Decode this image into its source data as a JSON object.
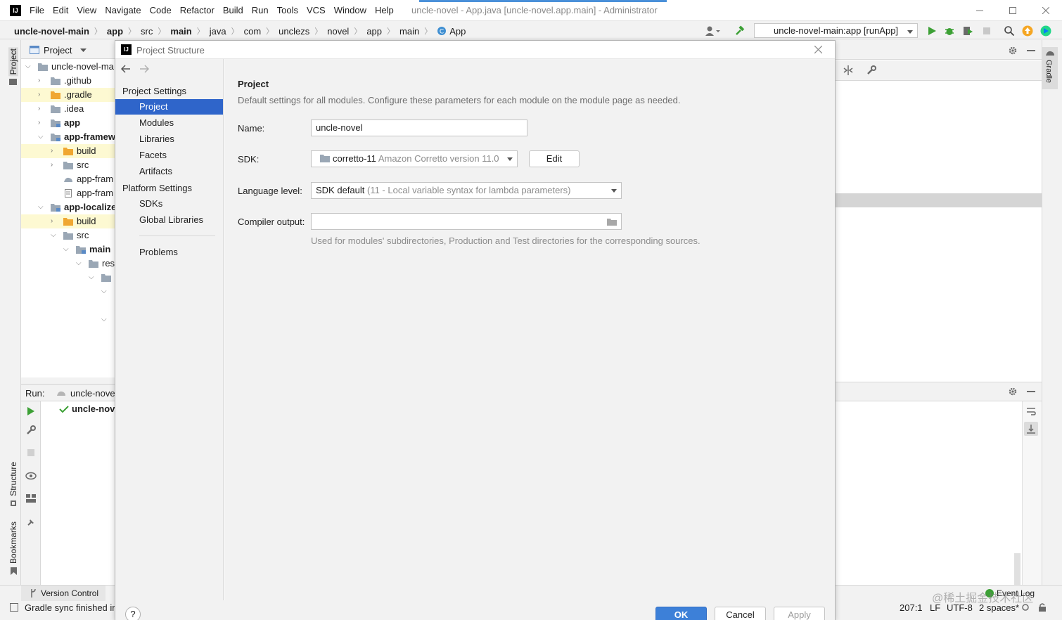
{
  "window": {
    "title": "uncle-novel - App.java [uncle-novel.app.main] - Administrator",
    "menu": [
      "File",
      "Edit",
      "View",
      "Navigate",
      "Code",
      "Refactor",
      "Build",
      "Run",
      "Tools",
      "VCS",
      "Window",
      "Help"
    ]
  },
  "navbar": {
    "crumbs": [
      "uncle-novel-main",
      "app",
      "src",
      "main",
      "java",
      "com",
      "unclezs",
      "novel",
      "app",
      "main",
      "App"
    ],
    "run_config": "uncle-novel-main:app [runApp]"
  },
  "left_stripe": {
    "project": "Project",
    "structure": "Structure",
    "bookmarks": "Bookmarks"
  },
  "project_panel": {
    "title": "Project",
    "tree": [
      {
        "label": "uncle-novel-ma",
        "bold": false
      },
      {
        "label": ".github"
      },
      {
        "label": ".gradle"
      },
      {
        "label": ".idea"
      },
      {
        "label": "app"
      },
      {
        "label": "app-framew"
      },
      {
        "label": "build"
      },
      {
        "label": "src"
      },
      {
        "label": "app-fram"
      },
      {
        "label": "app-fram"
      },
      {
        "label": "app-localize"
      },
      {
        "label": "build"
      },
      {
        "label": "src"
      },
      {
        "label": "main"
      },
      {
        "label": "res"
      }
    ]
  },
  "run_panel": {
    "label": "Run:",
    "tab": "uncle-nove",
    "item": "uncle-nov"
  },
  "bottom": {
    "version_control": "Version Control",
    "status": "Gradle sync finished in",
    "position": "207:1",
    "line_sep": "LF",
    "encoding": "UTF-8",
    "indent": "2 spaces*",
    "event_log": "Event Log",
    "watermark": "@稀土掘金技术社区"
  },
  "right_stripe": {
    "gradle": "Gradle"
  },
  "dialog": {
    "title": "Project Structure",
    "sections": {
      "project_settings": "Project Settings",
      "platform_settings": "Platform Settings"
    },
    "project_items": [
      "Project",
      "Modules",
      "Libraries",
      "Facets",
      "Artifacts"
    ],
    "platform_items": [
      "SDKs",
      "Global Libraries"
    ],
    "problems": "Problems",
    "heading": "Project",
    "description": "Default settings for all modules. Configure these parameters for each module on the module page as needed.",
    "name_label": "Name:",
    "name_value": "uncle-novel",
    "sdk_label": "SDK:",
    "sdk_name": "corretto-11",
    "sdk_detail": "Amazon Corretto version 11.0",
    "edit_button": "Edit",
    "language_label": "Language level:",
    "language_value": "SDK default",
    "language_detail": "(11 - Local variable syntax for lambda parameters)",
    "compiler_label": "Compiler output:",
    "compiler_value": "",
    "compiler_hint": "Used for modules' subdirectories, Production and Test directories for the corresponding sources.",
    "ok": "OK",
    "cancel": "Cancel",
    "apply": "Apply",
    "help": "?"
  },
  "colors": {
    "selection": "#2f65ca",
    "ok_button": "#3d80d8",
    "folder": "#f0a732",
    "run_green": "#3ca035"
  }
}
